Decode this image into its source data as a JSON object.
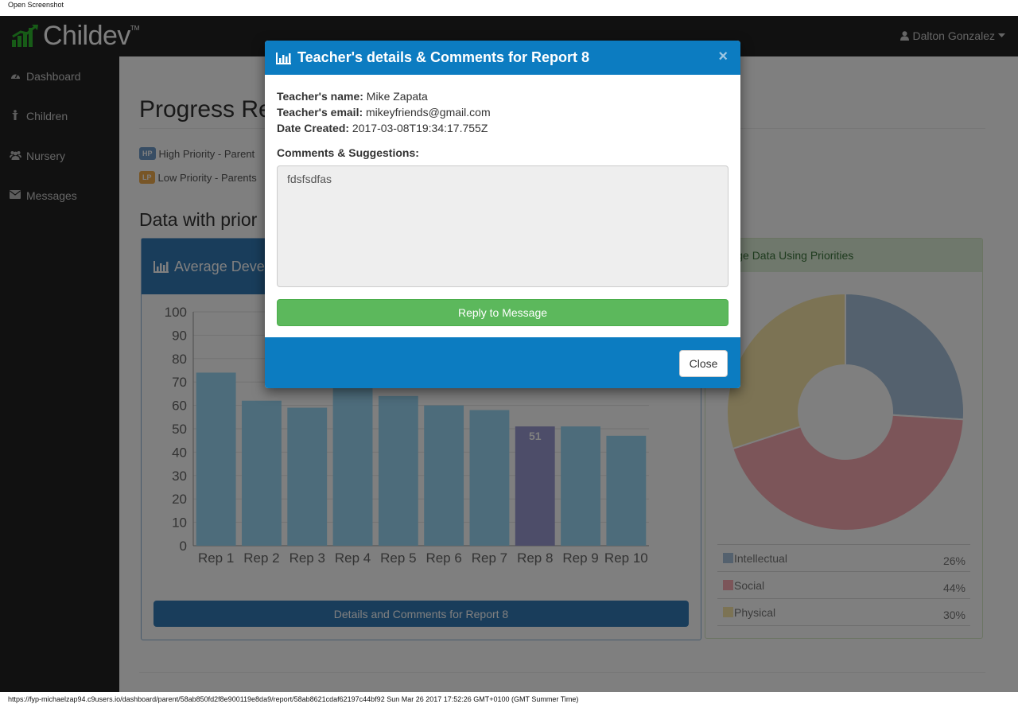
{
  "print": {
    "header": "Open Screenshot",
    "footer": "https://fyp-michaelzap94.c9users.io/dashboard/parent/58ab850fd2f8e900119e8da9/report/58ab8621cdaf62197c44bf92 Sun Mar 26 2017 17:52:26 GMT+0100 (GMT Summer Time)"
  },
  "brand": {
    "name": "Childev",
    "tm": "TM"
  },
  "user": {
    "name": "Dalton Gonzalez"
  },
  "sidebar": {
    "items": [
      {
        "label": "Dashboard",
        "icon": "dashboard-icon"
      },
      {
        "label": "Children",
        "icon": "child-icon"
      },
      {
        "label": "Nursery",
        "icon": "users-icon"
      },
      {
        "label": "Messages",
        "icon": "envelope-icon"
      }
    ]
  },
  "main": {
    "title": "Progress Re",
    "priorities": [
      {
        "badge": "HP",
        "text": "High Priority - Parent"
      },
      {
        "badge": "LP",
        "text": "Low Priority - Parents"
      }
    ],
    "section_title": "Data with prior",
    "bar_panel_title": "Average Devel",
    "details_button": "Details and Comments for Report 8",
    "pie_panel_title": "verage Data Using Priorities"
  },
  "chart_data": [
    {
      "type": "bar",
      "categories": [
        "Rep 1",
        "Rep 2",
        "Rep 3",
        "Rep 4",
        "Rep 5",
        "Rep 6",
        "Rep 7",
        "Rep 8",
        "Rep 9",
        "Rep 10"
      ],
      "values": [
        74,
        62,
        59,
        68,
        64,
        60,
        58,
        51,
        51,
        47
      ],
      "ylim": [
        0,
        100
      ],
      "yticks": [
        0,
        10,
        20,
        30,
        40,
        50,
        60,
        70,
        80,
        90,
        100
      ],
      "highlight_index": 7,
      "highlight_label": "51",
      "colors": {
        "bar": "#9ad9f7",
        "highlight": "#9b9bd2"
      }
    },
    {
      "type": "pie",
      "labels": [
        "Intellectual",
        "Social",
        "Physical"
      ],
      "values": [
        26,
        44,
        30
      ],
      "percent_labels": [
        "26%",
        "44%",
        "30%"
      ],
      "colors": [
        "#a8c3dc",
        "#f9aab2",
        "#f9e7a8"
      ]
    }
  ],
  "modal": {
    "title": "Teacher's details & Comments for Report 8",
    "teacher_name_label": "Teacher's name:",
    "teacher_name": "Mike Zapata",
    "teacher_email_label": "Teacher's email:",
    "teacher_email": "mikeyfriends@gmail.com",
    "date_label": "Date Created:",
    "date": "2017-03-08T19:34:17.755Z",
    "comments_label": "Comments & Suggestions:",
    "comments": "fdsfsdfas",
    "reply_button": "Reply to Message",
    "close_button": "Close",
    "close_x": "×"
  }
}
